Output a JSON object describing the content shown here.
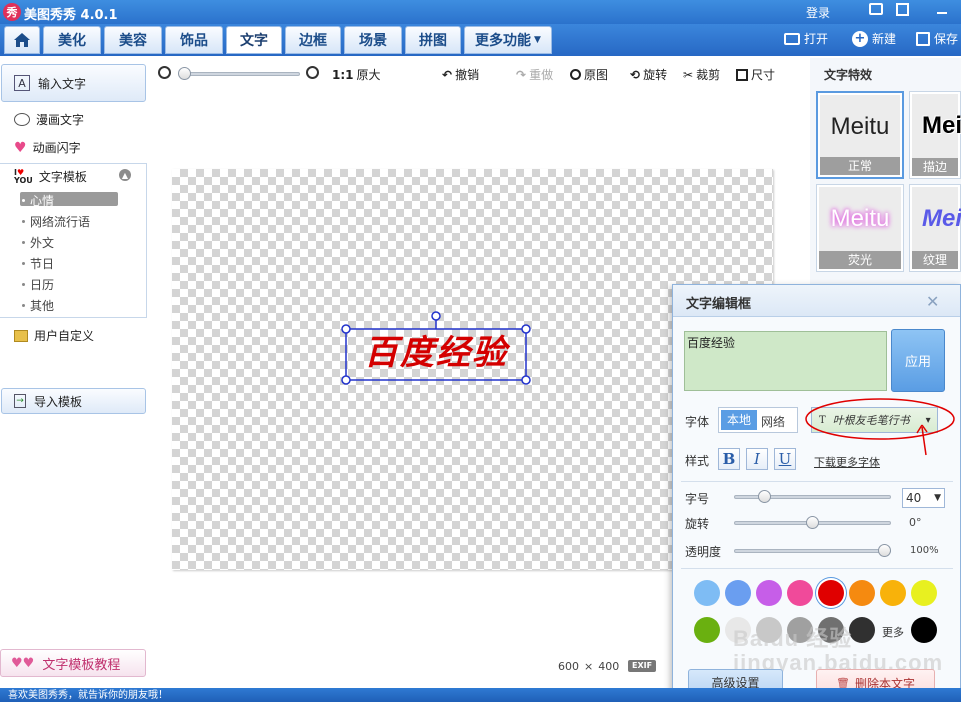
{
  "titlebar": {
    "logo": "秀",
    "title": "美图秀秀 4.0.1",
    "login": "登录"
  },
  "tabs": [
    "美化",
    "美容",
    "饰品",
    "文字",
    "边框",
    "场景",
    "拼图",
    "更多功能"
  ],
  "header_actions": {
    "open": "打开",
    "new": "新建",
    "save": "保存"
  },
  "toolbar": {
    "zoom": "1:1",
    "original_size": "原大",
    "undo": "撤销",
    "redo": "重做",
    "original": "原图",
    "rotate": "旋转",
    "crop": "裁剪",
    "size": "尺寸"
  },
  "sidebar": {
    "input_text": "输入文字",
    "comic_text": "漫画文字",
    "animated_text": "动画闪字",
    "template": "文字模板",
    "template_categories": [
      "心情",
      "网络流行语",
      "外文",
      "节日",
      "日历",
      "其他"
    ],
    "custom": "用户自定义",
    "import_template": "导入模板",
    "tutorial": "文字模板教程"
  },
  "canvas": {
    "text": "百度经验",
    "width": "600",
    "height": "400",
    "exif": "EXIF"
  },
  "effects": {
    "title": "文字特效",
    "items": [
      {
        "preview": "Meitu",
        "label": "正常"
      },
      {
        "preview": "Mei",
        "label": "描边"
      },
      {
        "preview": "Meitu",
        "label": "荧光"
      },
      {
        "preview": "Mei",
        "label": "纹理"
      }
    ]
  },
  "dialog": {
    "title": "文字编辑框",
    "text_value": "百度经验",
    "apply": "应用",
    "font_label": "字体",
    "font_tab_local": "本地",
    "font_tab_network": "网络",
    "font_value": "叶根友毛笔行书",
    "style_label": "样式",
    "bold": "B",
    "italic": "I",
    "underline": "U",
    "download_fonts": "下载更多字体",
    "size_label": "字号",
    "size_value": "40",
    "rotate_label": "旋转",
    "rotate_value": "0°",
    "opacity_label": "透明度",
    "opacity_value": "100%",
    "more": "更多",
    "advanced": "高级设置",
    "delete": "删除本文字",
    "colors": [
      "#7ebcf4",
      "#6a9ef0",
      "#c65ee8",
      "#f04a9a",
      "#e00000",
      "#f58a10",
      "#f8b20a",
      "#e8f020",
      "#6ab010",
      "#e8e8e8",
      "#c8c8c8",
      "#a0a0a0",
      "#707070",
      "#303030",
      "#ffffff",
      "#000000"
    ]
  },
  "status": {
    "text": "喜欢美图秀秀，就告诉你的朋友哦！"
  },
  "watermark": "Baidu 经验 jingyan.baidu.com",
  "accent": {
    "text_color": "#d40000",
    "selection": "#2233cc",
    "annotation": "#e00000"
  }
}
